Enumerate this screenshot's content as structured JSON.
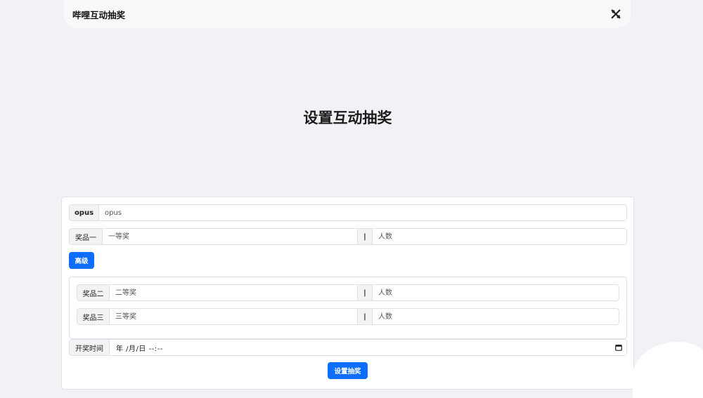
{
  "navbar": {
    "brand": "哔哩互动抽奖",
    "icon": "tools-icon"
  },
  "page_title": "设置互动抽奖",
  "form": {
    "opus": {
      "label": "opus",
      "placeholder": "opus"
    },
    "prize1": {
      "label": "奖品一",
      "name_placeholder": "一等奖",
      "separator": "|",
      "count_placeholder": "人数"
    },
    "advanced_button": "高级",
    "prize2": {
      "label": "奖品二",
      "name_placeholder": "二等奖",
      "separator": "|",
      "count_placeholder": "人数"
    },
    "prize3": {
      "label": "奖品三",
      "name_placeholder": "三等奖",
      "separator": "|",
      "count_placeholder": "人数"
    },
    "draw_time": {
      "label": "开奖时间",
      "value": "年 /月/日 --:--",
      "icon": "calendar-icon"
    },
    "submit_button": "设置抽奖"
  }
}
